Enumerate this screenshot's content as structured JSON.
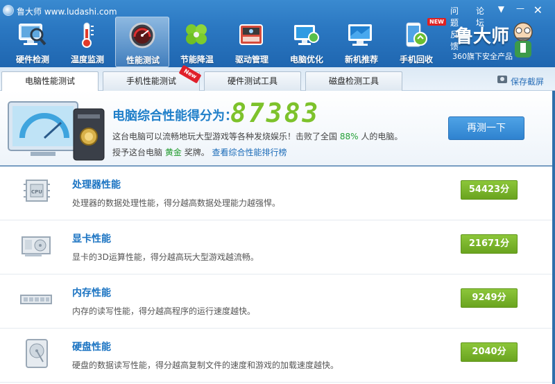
{
  "app": {
    "title": "鲁大师 www.ludashi.com",
    "links": {
      "feedback": "问题反馈",
      "forum": "论坛",
      "menu": "▼",
      "minimize": "—",
      "close": "✕"
    }
  },
  "nav": [
    {
      "label": "硬件检测",
      "icon": "monitor-magnifier-icon",
      "active": false
    },
    {
      "label": "温度监测",
      "icon": "thermometer-icon",
      "active": false
    },
    {
      "label": "性能测试",
      "icon": "speedometer-icon",
      "active": true
    },
    {
      "label": "节能降温",
      "icon": "clover-icon",
      "active": false
    },
    {
      "label": "驱动管理",
      "icon": "driver-chip-icon",
      "active": false
    },
    {
      "label": "电脑优化",
      "icon": "computer-optimize-icon",
      "active": false
    },
    {
      "label": "新机推荐",
      "icon": "new-computer-icon",
      "active": false
    },
    {
      "label": "手机回收",
      "icon": "phone-recycle-icon",
      "active": false,
      "badge": "NEW"
    }
  ],
  "brand": {
    "name": "鲁大师",
    "subtitle": "360旗下安全产品"
  },
  "tabs": [
    {
      "label": "电脑性能测试",
      "active": true
    },
    {
      "label": "手机性能测试",
      "active": false,
      "badge": "New"
    },
    {
      "label": "硬件测试工具",
      "active": false
    },
    {
      "label": "磁盘检测工具",
      "active": false
    }
  ],
  "save_screenshot": "保存截屏",
  "score": {
    "label": "电脑综合性能得分为：",
    "value": "87383",
    "desc_prefix": "这台电脑可以流畅地玩大型游戏等各种发烧娱乐！击败了全国",
    "beat_percent": "88%",
    "desc_suffix": "人的电脑。",
    "award_prefix": "授予这台电脑",
    "award_medal": "黄金",
    "award_suffix": "奖牌。",
    "rank_link": "查看综合性能排行榜",
    "retest_label": "再测一下"
  },
  "categories": [
    {
      "title": "处理器性能",
      "desc": "处理器的数据处理性能，得分越高数据处理能力越强悍。",
      "score": "54423分",
      "icon": "cpu-chip-icon"
    },
    {
      "title": "显卡性能",
      "desc": "显卡的3D运算性能，得分越高玩大型游戏越流畅。",
      "score": "21671分",
      "icon": "graphics-card-icon"
    },
    {
      "title": "内存性能",
      "desc": "内存的读写性能，得分越高程序的运行速度越快。",
      "score": "9249分",
      "icon": "memory-module-icon"
    },
    {
      "title": "硬盘性能",
      "desc": "硬盘的数据读写性能，得分越高复制文件的速度和游戏的加载速度越快。",
      "score": "2040分",
      "icon": "hard-disk-icon"
    }
  ],
  "colors": {
    "accent": "#1f7fc9",
    "score_green": "#7dc22b",
    "badge_green": "#6aa41f",
    "header_blue": "#2b78c2"
  }
}
